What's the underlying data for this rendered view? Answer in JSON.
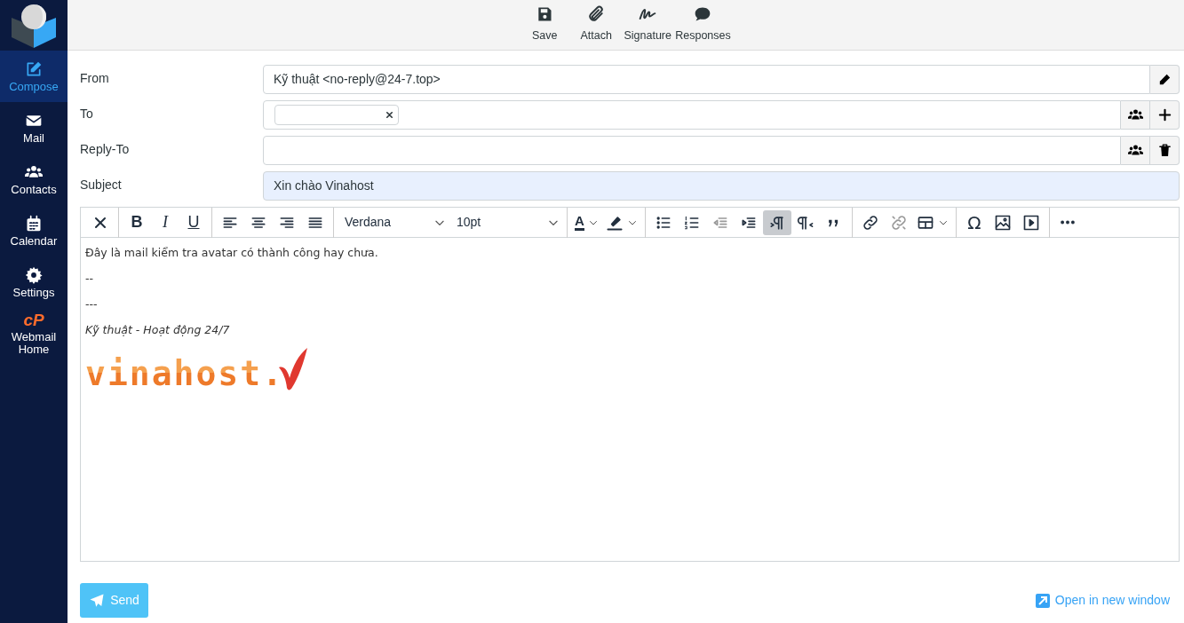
{
  "sidebar": {
    "items": [
      {
        "label": "Compose",
        "selected": true
      },
      {
        "label": "Mail",
        "selected": false
      },
      {
        "label": "Contacts",
        "selected": false
      },
      {
        "label": "Calendar",
        "selected": false
      },
      {
        "label": "Settings",
        "selected": false
      },
      {
        "label": "Webmail Home",
        "selected": false,
        "logo_text": "cP"
      }
    ]
  },
  "toolbar": {
    "buttons": [
      "Save",
      "Attach",
      "Signature",
      "Responses"
    ]
  },
  "form": {
    "rows": [
      {
        "kind": "identity",
        "label": "From",
        "value": "Kỹ thuật <no-reply@24-7.top>",
        "focused": false
      },
      {
        "kind": "recipients",
        "label": "To",
        "value": "",
        "focused": false
      },
      {
        "kind": "plain",
        "label": "Reply-To",
        "value": "",
        "focused": false
      },
      {
        "kind": "text",
        "label": "Subject",
        "value": "Xin chào Vinahost",
        "focused": true
      }
    ]
  },
  "editor": {
    "toolbar": [
      [
        {
          "kind": "button",
          "active": false,
          "disabled": false
        }
      ],
      [
        {
          "kind": "button",
          "label": "B",
          "active": false,
          "disabled": false
        },
        {
          "kind": "button",
          "label": "I",
          "active": false,
          "disabled": false
        },
        {
          "kind": "button",
          "label": "U",
          "active": false,
          "disabled": false
        }
      ],
      [
        {
          "kind": "button",
          "active": false,
          "disabled": false
        },
        {
          "kind": "button",
          "active": false,
          "disabled": false
        },
        {
          "kind": "button",
          "active": false,
          "disabled": false
        },
        {
          "kind": "button",
          "active": false,
          "disabled": false
        }
      ],
      [
        {
          "kind": "select",
          "value": "Verdana"
        },
        {
          "kind": "select",
          "value": "10pt"
        }
      ],
      [
        {
          "kind": "split",
          "label": "A",
          "active": false,
          "disabled": false
        },
        {
          "kind": "split",
          "active": false,
          "disabled": false
        }
      ],
      [
        {
          "kind": "button",
          "active": false,
          "disabled": false
        },
        {
          "kind": "button",
          "active": false,
          "disabled": false
        },
        {
          "kind": "button",
          "active": false,
          "disabled": true
        },
        {
          "kind": "button",
          "active": false,
          "disabled": false
        },
        {
          "kind": "button",
          "active": true,
          "disabled": false
        },
        {
          "kind": "button",
          "active": false,
          "disabled": false
        },
        {
          "kind": "button",
          "active": false,
          "disabled": false
        }
      ],
      [
        {
          "kind": "button",
          "active": false,
          "disabled": false
        },
        {
          "kind": "button",
          "active": false,
          "disabled": true
        },
        {
          "kind": "split",
          "active": false,
          "disabled": false
        }
      ],
      [
        {
          "kind": "button",
          "label": "Ω",
          "active": false,
          "disabled": false
        },
        {
          "kind": "button",
          "active": false,
          "disabled": false
        },
        {
          "kind": "button",
          "active": false,
          "disabled": false
        }
      ],
      [
        {
          "kind": "button",
          "active": false,
          "disabled": false
        }
      ]
    ],
    "body": [
      {
        "kind": "text",
        "text": "Đây là mail kiểm tra avatar có thành công hay chưa."
      },
      {
        "kind": "text",
        "text": "--"
      },
      {
        "kind": "text",
        "text": "---"
      },
      {
        "kind": "italic",
        "text": "Kỹ thuật - Hoạt động 24/7"
      },
      {
        "kind": "logo",
        "text": "vinahost."
      }
    ]
  },
  "footer": {
    "send": "Send",
    "open_window": "Open in new window"
  }
}
